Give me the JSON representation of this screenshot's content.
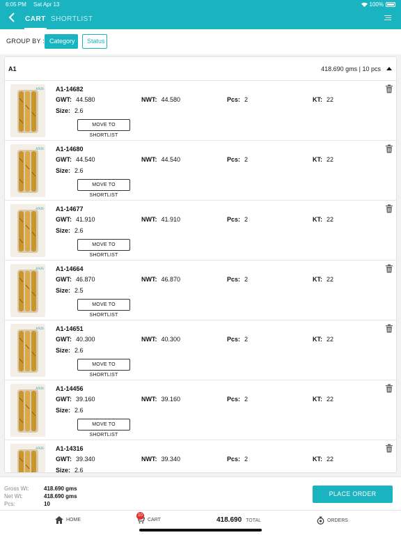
{
  "status_bar": {
    "time": "6:05 PM",
    "date": "Sat Apr 13",
    "battery": "100%"
  },
  "nav": {
    "tabs": [
      "CART",
      "SHORTLIST"
    ],
    "active_tab": "CART"
  },
  "group_by": {
    "label": "GROUP BY :",
    "options": [
      "Category",
      "Status"
    ],
    "selected": "Category"
  },
  "section": {
    "title": "A1",
    "summary": "418.690 gms | 10 pcs",
    "labels": {
      "gwt": "GWT:",
      "nwt": "NWT:",
      "pcs": "Pcs:",
      "kt": "KT:",
      "size": "Size:"
    },
    "move_label": "MOVE TO SHORTLIST",
    "items": [
      {
        "code": "A1-14682",
        "gwt": "44.580",
        "nwt": "44.580",
        "pcs": "2",
        "kt": "22",
        "size": "2.6"
      },
      {
        "code": "A1-14680",
        "gwt": "44.540",
        "nwt": "44.540",
        "pcs": "2",
        "kt": "22",
        "size": "2.6"
      },
      {
        "code": "A1-14677",
        "gwt": "41.910",
        "nwt": "41.910",
        "pcs": "2",
        "kt": "22",
        "size": "2.6"
      },
      {
        "code": "A1-14664",
        "gwt": "46.870",
        "nwt": "46.870",
        "pcs": "2",
        "kt": "22",
        "size": "2.5"
      },
      {
        "code": "A1-14651",
        "gwt": "40.300",
        "nwt": "40.300",
        "pcs": "2",
        "kt": "22",
        "size": "2.6"
      },
      {
        "code": "A1-14456",
        "gwt": "39.160",
        "nwt": "39.160",
        "pcs": "2",
        "kt": "22",
        "size": "2.6"
      },
      {
        "code": "A1-14316",
        "gwt": "39.340",
        "nwt": "39.340",
        "pcs": "2",
        "kt": "22",
        "size": "2.6"
      }
    ]
  },
  "footer": {
    "gross_wt_label": "Gross Wt:",
    "gross_wt": "418.690 gms",
    "net_wt_label": "Net Wt:",
    "net_wt": "418.690 gms",
    "pcs_label": "Pcs:",
    "pcs": "10",
    "place_order": "PLACE ORDER"
  },
  "bottom_nav": {
    "home": "HOME",
    "cart": "CART",
    "cart_badge": "10",
    "total_value": "418.690",
    "total_label": "TOTAL",
    "orders": "ORDERS"
  },
  "colors": {
    "accent": "#1ab3c0",
    "badge": "#e0332e",
    "gold": "#c9962e"
  },
  "icons": [
    "back-icon",
    "menu-icon",
    "trash-icon",
    "collapse-icon",
    "home-icon",
    "cart-icon",
    "orders-icon"
  ]
}
